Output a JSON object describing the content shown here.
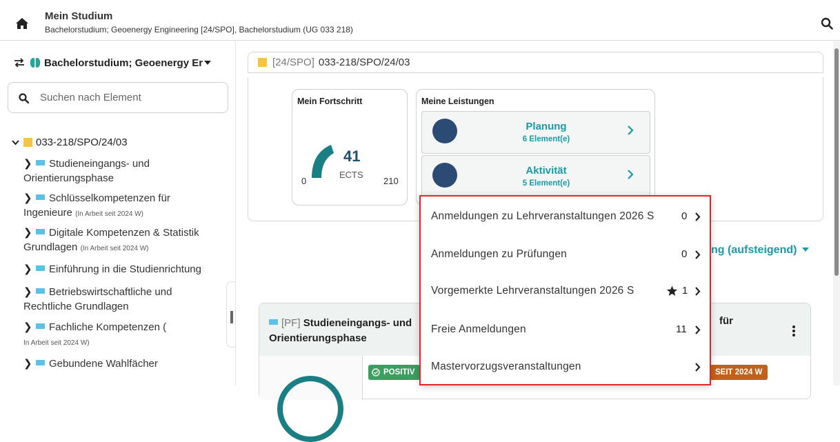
{
  "header": {
    "title": "Mein Studium",
    "subtitle": "Bachelorstudium; Geoenergy Engineering [24/SPO], Bachelorstudium (UG 033 218)"
  },
  "sidebar": {
    "study_switch_label": "Bachelorstudium; Geoenergy Er",
    "search_placeholder": "Suchen nach Element",
    "root_label": "033-218/SPO/24/03",
    "items": [
      {
        "line1": "Studieneingangs- und",
        "line2": "Orientierungsphase",
        "note": ""
      },
      {
        "line1": "Schlüsselkompetenzen für",
        "line2": "Ingenieure",
        "note": "(In Arbeit seit 2024 W)"
      },
      {
        "line1": "Digitale Kompetenzen & Statistik",
        "line2": "Grundlagen",
        "note": "(In Arbeit seit 2024 W)"
      },
      {
        "line1": "Einführung in die Studienrichtung",
        "line2": "",
        "note": ""
      },
      {
        "line1": "Betriebswirtschaftliche und",
        "line2": "Rechtliche Grundlagen",
        "note": ""
      },
      {
        "line1": "Fachliche Kompetenzen (",
        "line2": "",
        "note": "In Arbeit seit 2024 W)"
      },
      {
        "line1": "Gebundene Wahlfächer",
        "line2": "",
        "note": ""
      }
    ]
  },
  "main": {
    "spo_tag": "[24/SPO]",
    "spo_label": "033-218/SPO/24/03",
    "progress": {
      "title": "Mein Fortschritt",
      "ects_value": "41",
      "ects_label": "ECTS",
      "min": "0",
      "max": "210",
      "fraction": 0.195
    },
    "leistungen": {
      "title": "Meine Leistungen",
      "rows": [
        {
          "label": "Planung",
          "count": "6 Element(e)"
        },
        {
          "label": "Aktivität",
          "count": "5 Element(e)"
        }
      ]
    },
    "sort_label": "ng (aufsteigend)",
    "module": {
      "tag": "[PF]",
      "title_bold": "Studieneingangs- und",
      "title_line2": "Orientierungsphase",
      "right_text": "für",
      "badge_positive": "POSITIV",
      "badge_since": "SEIT 2024 W"
    }
  },
  "popup": {
    "items": [
      {
        "label": "Anmeldungen zu Lehrveranstaltungen 2026 S",
        "count": "0",
        "starred": false
      },
      {
        "label": "Anmeldungen zu Prüfungen",
        "count": "0",
        "starred": false
      },
      {
        "label": "Vorgemerkte Lehrveranstaltungen 2026 S",
        "count": "1",
        "starred": true
      },
      {
        "label": "Freie Anmeldungen",
        "count": "11",
        "starred": false
      },
      {
        "label": "Mastervorzugsveranstaltungen",
        "count": "",
        "starred": false
      }
    ]
  },
  "colors": {
    "accent_teal": "#1a9aa6",
    "highlight_border": "#e1262b",
    "spo_square": "#f5c542",
    "module_square": "#5bc1e6",
    "badge_positive": "#3a9f5f",
    "badge_since": "#c2621a"
  },
  "icons": [
    "home-icon",
    "search-icon",
    "switch-arrows-icon",
    "brain-icon",
    "caret-down-icon",
    "chevron-down-icon",
    "chevron-right-icon",
    "star-icon",
    "kebab-menu-icon",
    "check-circle-icon",
    "collapse-handle-icon"
  ]
}
